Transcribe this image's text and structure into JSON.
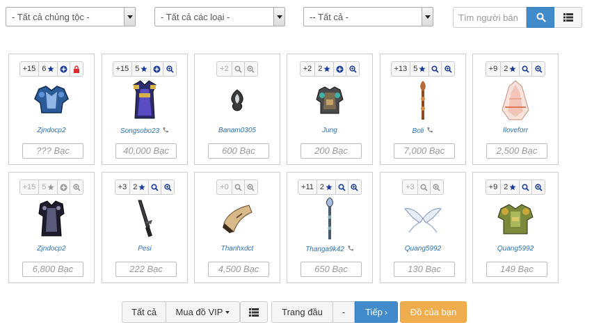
{
  "filters": {
    "race": "- Tất cả chủng tộc -",
    "type": "- Tất cả các loại -",
    "other": "-- Tất cả -",
    "search_placeholder": "Tìm người bán"
  },
  "items": [
    {
      "level": "+15",
      "stars": "6",
      "dim": false,
      "seller": "Zjndocp2",
      "phone": false,
      "price": "??? Bạc"
    },
    {
      "level": "+15",
      "stars": "5",
      "dim": false,
      "seller": "Songsobo23",
      "phone": true,
      "price": "40,000 Bạc"
    },
    {
      "level": "+2",
      "stars": "",
      "dim": true,
      "seller": "Banam0305",
      "phone": false,
      "price": "600 Bạc"
    },
    {
      "level": "+2",
      "stars": "2",
      "dim": false,
      "seller": "Jung",
      "phone": false,
      "price": "200 Bạc"
    },
    {
      "level": "+13",
      "stars": "5",
      "dim": false,
      "seller": "Boli",
      "phone": true,
      "price": "7,000 Bạc"
    },
    {
      "level": "+9",
      "stars": "2",
      "dim": false,
      "seller": "Iloveforr",
      "phone": false,
      "price": "2,500 Bạc"
    },
    {
      "level": "+15",
      "stars": "5",
      "dim": true,
      "seller": "Zjndocp2",
      "phone": false,
      "price": "6,800 Bạc"
    },
    {
      "level": "+3",
      "stars": "2",
      "dim": false,
      "seller": "Pesi",
      "phone": false,
      "price": "222 Bạc"
    },
    {
      "level": "+0",
      "stars": "",
      "dim": true,
      "seller": "Thanhxdct",
      "phone": false,
      "price": "4,500 Bạc"
    },
    {
      "level": "+11",
      "stars": "2",
      "dim": false,
      "seller": "Thanga9k42",
      "phone": true,
      "price": "650 Bạc"
    },
    {
      "level": "+3",
      "stars": "",
      "dim": true,
      "seller": "Quang5992",
      "phone": false,
      "price": "130 Bạc"
    },
    {
      "level": "+9",
      "stars": "2",
      "dim": false,
      "seller": "Quang5992",
      "phone": false,
      "price": "149 Bạc"
    }
  ],
  "pager": {
    "all": "Tất cả",
    "vip": "Mua đồ VIP",
    "first": "Trang đầu",
    "dash": "-",
    "next": "Tiếp",
    "mine": "Đồ của bạn"
  }
}
